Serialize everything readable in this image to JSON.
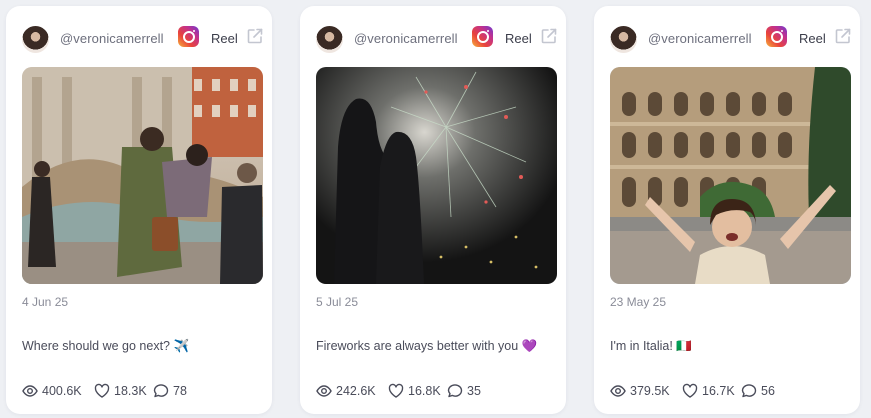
{
  "posts": [
    {
      "handle": "@veronicamerrell",
      "type_label": "Reel",
      "date": "4 Jun 25",
      "caption": "Where should we go next? ✈️",
      "views": "400.6K",
      "likes": "18.3K",
      "comments": "78"
    },
    {
      "handle": "@veronicamerrell",
      "type_label": "Reel",
      "date": "5 Jul 25",
      "caption": "Fireworks are always better with you 💜",
      "views": "242.6K",
      "likes": "16.8K",
      "comments": "35"
    },
    {
      "handle": "@veronicamerrell",
      "type_label": "Reel",
      "date": "23 May 25",
      "caption": "I'm in Italia! 🇮🇹",
      "views": "379.5K",
      "likes": "16.7K",
      "comments": "56"
    }
  ],
  "icons": {
    "platform": "instagram-icon",
    "external": "external-link-icon",
    "views": "eye-icon",
    "likes": "heart-icon",
    "comments": "comment-icon"
  }
}
